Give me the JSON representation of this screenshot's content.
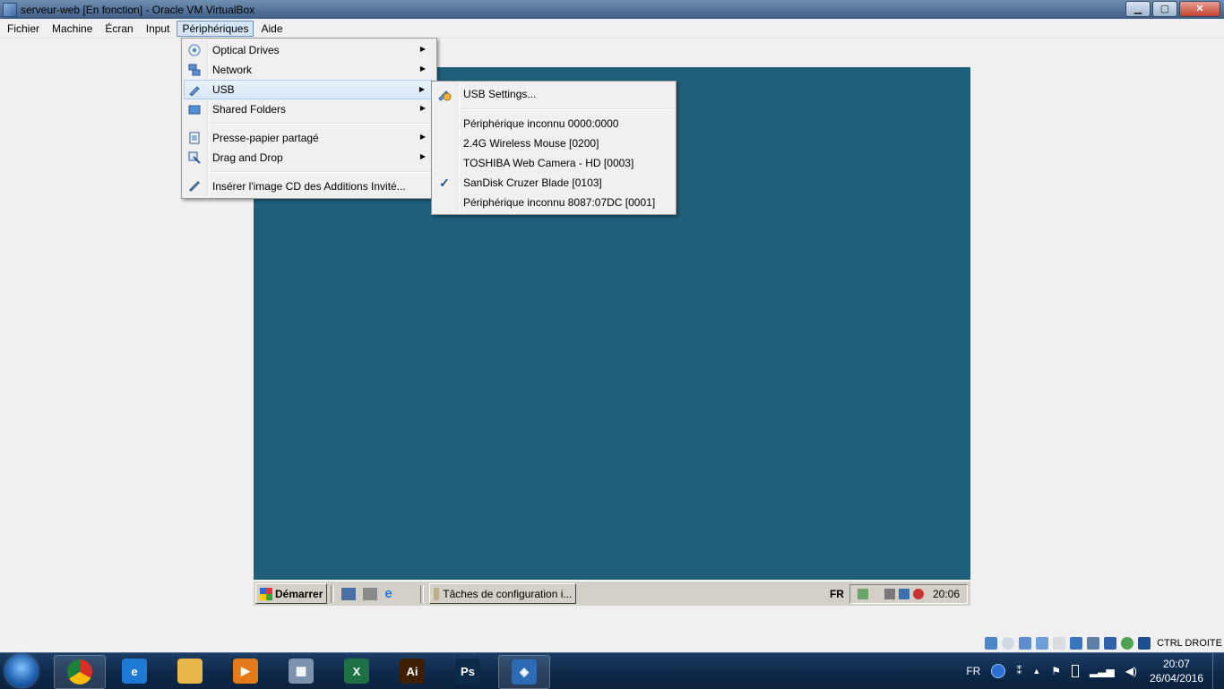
{
  "window": {
    "title": "serveur-web [En fonction] - Oracle VM VirtualBox",
    "controls": {
      "minimize": "▁",
      "maximize": "▢",
      "close": "✕"
    }
  },
  "menubar": [
    "Fichier",
    "Machine",
    "Écran",
    "Input",
    "Périphériques",
    "Aide"
  ],
  "devices_menu": {
    "items": [
      {
        "label": "Optical Drives",
        "icon": "optical-drive-icon"
      },
      {
        "label": "Network",
        "icon": "network-icon"
      },
      {
        "label": "USB",
        "icon": "usb-icon"
      },
      {
        "label": "Shared Folders",
        "icon": "shared-folder-icon"
      },
      {
        "label": "Presse-papier partagé",
        "icon": "clipboard-icon"
      },
      {
        "label": "Drag and Drop",
        "icon": "drag-drop-icon"
      },
      {
        "label": "Insérer l'image CD des Additions Invité...",
        "icon": "guest-additions-icon"
      }
    ],
    "arrow": "▶"
  },
  "usb_menu": {
    "settings": "USB Settings...",
    "devices": [
      "Périphérique inconnu 0000:0000",
      "2.4G Wireless Mouse [0200]",
      "TOSHIBA Web Camera - HD [0003]",
      "SanDisk Cruzer Blade [0103]",
      "Périphérique inconnu 8087:07DC [0001]"
    ],
    "checked_device": "SanDisk Cruzer Blade [0103]",
    "check_mark": "✓"
  },
  "guest_taskbar": {
    "start": "Démarrer",
    "task": "Tâches de configuration i...",
    "lang": "FR",
    "time": "20:06"
  },
  "host_status": {
    "key": "CTRL DROITE"
  },
  "host_taskbar": {
    "pinned": [
      {
        "name": "chrome",
        "glyph": "",
        "color": "#d93025"
      },
      {
        "name": "internet-explorer",
        "glyph": "e",
        "color": "#1f7ad6"
      },
      {
        "name": "explorer",
        "glyph": "",
        "color": "#e8b84a"
      },
      {
        "name": "media-player",
        "glyph": "▶",
        "color": "#e57a1a"
      },
      {
        "name": "calculator",
        "glyph": "▦",
        "color": "#7d93ad"
      },
      {
        "name": "excel",
        "glyph": "X",
        "color": "#1e7145"
      },
      {
        "name": "illustrator",
        "glyph": "Ai",
        "color": "#3d1e00"
      },
      {
        "name": "photoshop",
        "glyph": "Ps",
        "color": "#0b2a4a"
      },
      {
        "name": "virtualbox",
        "glyph": "◈",
        "color": "#2e6bb5"
      }
    ],
    "lang": "FR",
    "time": "20:07",
    "date": "26/04/2016"
  }
}
